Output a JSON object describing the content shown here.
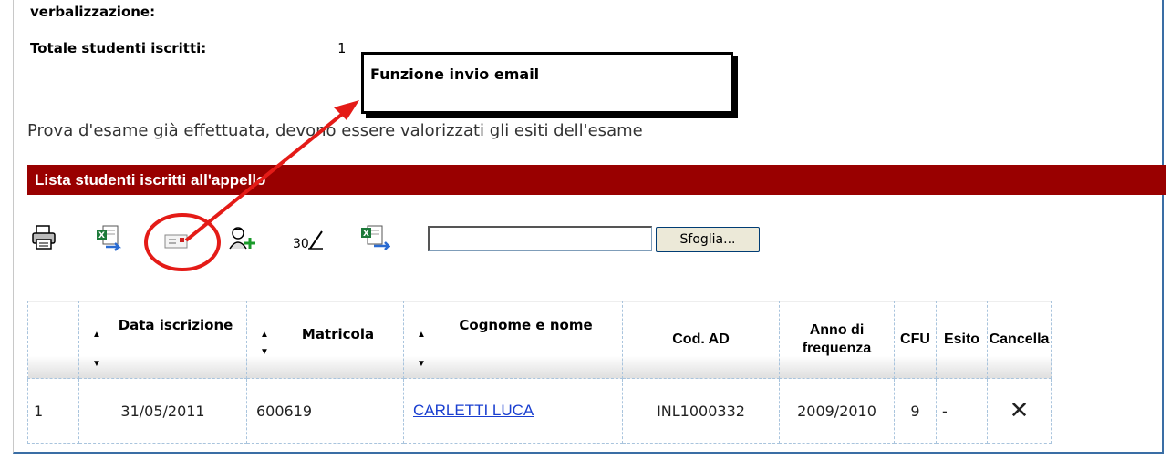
{
  "summary": {
    "heading_cut": "verbalizzazione:",
    "total_label": "Totale studenti iscritti:",
    "total_value": "1"
  },
  "status_message": "Prova d'esame già effettuata, devono essere valorizzati gli esiti dell'esame",
  "section_title": "Lista studenti iscritti all'appello",
  "callout": {
    "text": "Funzione invio email",
    "highlight_color": "#e41b17"
  },
  "toolbar": {
    "icons": [
      "printer-icon",
      "excel-export-icon",
      "email-icon",
      "add-student-icon",
      "grade-entry-icon",
      "excel-import-icon"
    ],
    "file_value": "",
    "browse_label": "Sfoglia..."
  },
  "table": {
    "columns": [
      "",
      "Data iscrizione",
      "Matricola",
      "Cognome e nome",
      "Cod. AD",
      "Anno di frequenza",
      "CFU",
      "Esito",
      "Cancella"
    ],
    "sort_up": "▲",
    "sort_down": "▼",
    "rows": [
      {
        "index": "1",
        "data_iscrizione": "31/05/2011",
        "matricola": "600619",
        "nome": "CARLETTI LUCA",
        "cod_ad": "INL1000332",
        "anno": "2009/2010",
        "cfu": "9",
        "esito": "-",
        "delete_glyph": "✕"
      }
    ]
  },
  "colors": {
    "bar": "#990000",
    "frame": "#3a6ea5",
    "link": "#1a3fd0"
  }
}
